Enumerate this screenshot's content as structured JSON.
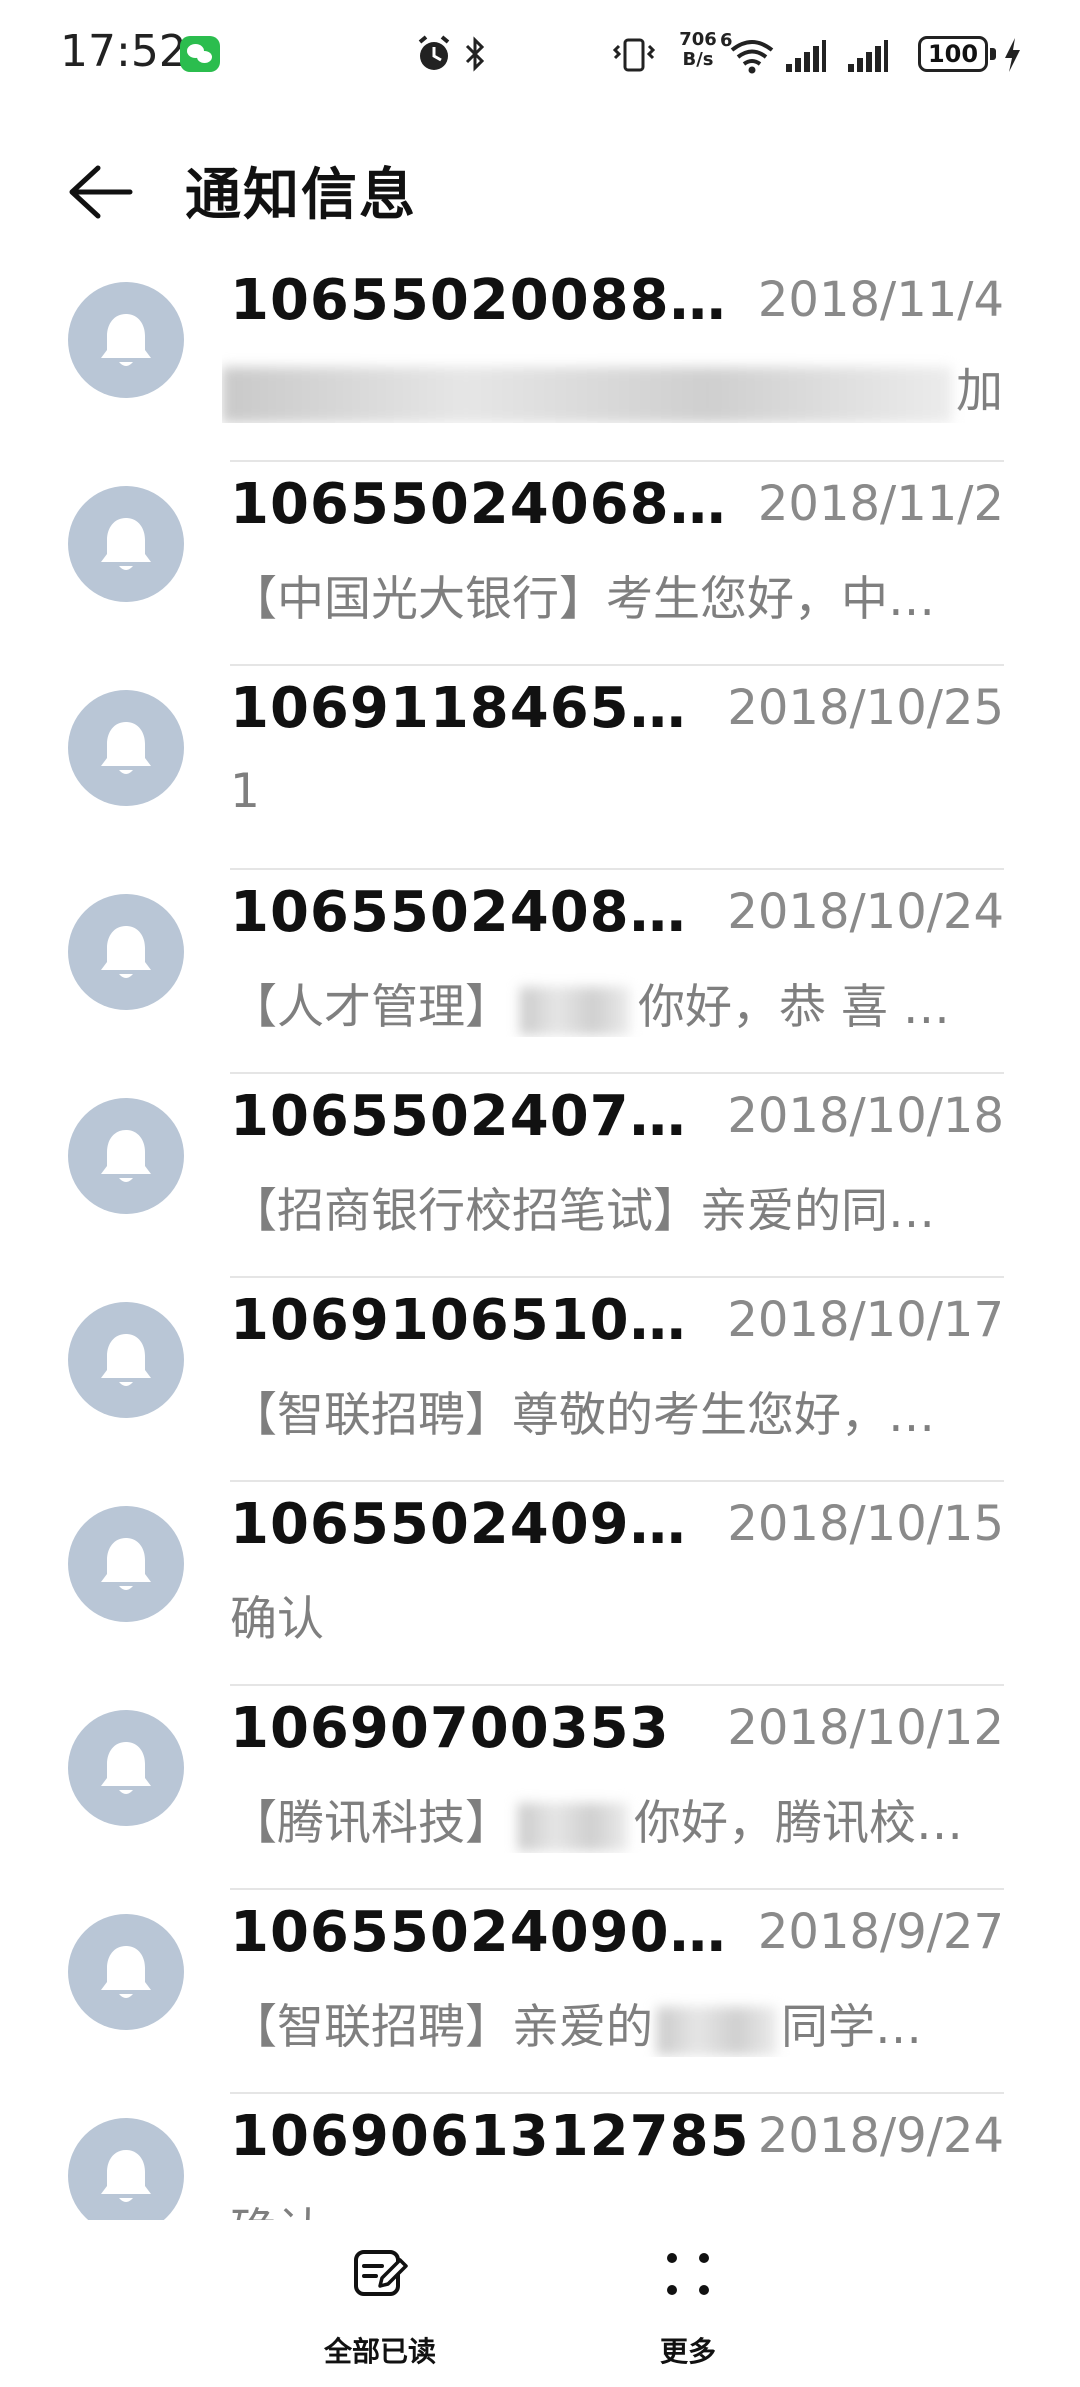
{
  "status_bar": {
    "time": "17:52",
    "net_speed_value": "706",
    "net_speed_unit": "B/s",
    "wifi_label": "6",
    "battery": "100",
    "icons": [
      "wechat-icon",
      "alarm-icon",
      "bluetooth-icon",
      "vibrate-icon",
      "wifi-icon",
      "signal-icon",
      "signal-icon",
      "battery-icon",
      "charging-icon"
    ]
  },
  "header": {
    "title": "通知信息"
  },
  "messages": [
    {
      "sender": "10655020088…",
      "date": "2018/11/4",
      "preview": "加",
      "blurred": true
    },
    {
      "sender": "10655024068…",
      "date": "2018/11/2",
      "preview": "【中国光大银行】考生您好，中…"
    },
    {
      "sender": "1069118465…",
      "date": "2018/10/25",
      "preview": "1"
    },
    {
      "sender": "1065502408…",
      "date": "2018/10/24",
      "preview_a": "【人才管理】",
      "preview_b": "你好，恭 喜 …"
    },
    {
      "sender": "1065502407…",
      "date": "2018/10/18",
      "preview": "【招商银行校招笔试】亲爱的同…"
    },
    {
      "sender": "1069106510…",
      "date": "2018/10/17",
      "preview": "【智联招聘】尊敬的考生您好，…"
    },
    {
      "sender": "1065502409…",
      "date": "2018/10/15",
      "preview": "确认"
    },
    {
      "sender": "10690700353",
      "date": "2018/10/12",
      "preview_a": "【腾讯科技】",
      "preview_b": "你好，腾讯校…"
    },
    {
      "sender": "10655024090…",
      "date": "2018/9/27",
      "preview_a": "【智联招聘】亲爱的",
      "preview_b": "同学…"
    },
    {
      "sender": "1069061312785",
      "date": "2018/9/24",
      "preview": "确认"
    }
  ],
  "bottom_bar": {
    "mark_all_read": "全部已读",
    "more": "更多"
  },
  "colors": {
    "avatar_bg": "#b9c6d6",
    "date_text": "#8a8a8a",
    "preview_text": "#7f7f7f",
    "wechat_green": "#2bbd4e"
  }
}
